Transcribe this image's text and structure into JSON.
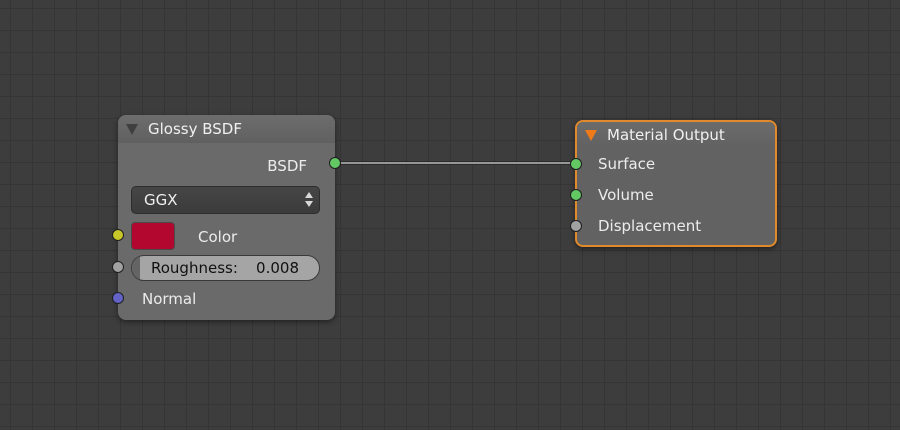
{
  "glossy_node": {
    "title": "Glossy BSDF",
    "output_label": "BSDF",
    "distribution": "GGX",
    "color_label": "Color",
    "color_value": "#b3072f",
    "roughness_label": "Roughness:",
    "roughness_value": "0.008",
    "normal_label": "Normal"
  },
  "material_output": {
    "title": "Material Output",
    "inputs": [
      {
        "label": "Surface",
        "socket_color": "#63c763"
      },
      {
        "label": "Volume",
        "socket_color": "#63c763"
      },
      {
        "label": "Displacement",
        "socket_color": "#a1a1a1"
      }
    ],
    "border_color": "#e08a2c"
  },
  "icons": {
    "collapse": "collapse-arrow-icon",
    "updown": "updown-arrows-icon"
  }
}
